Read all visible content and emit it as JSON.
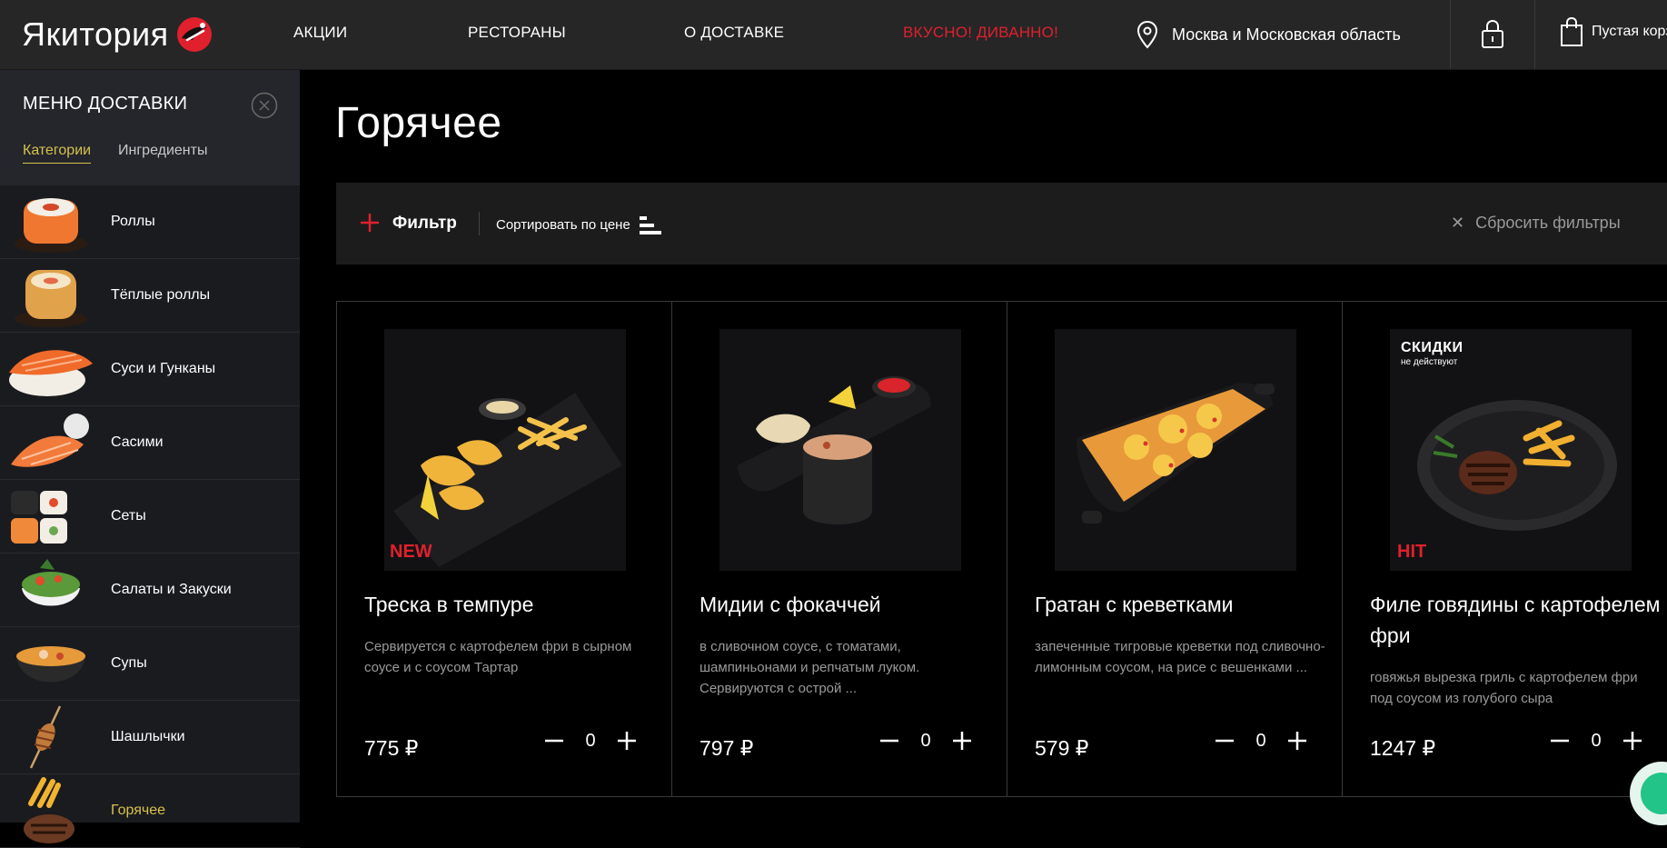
{
  "header": {
    "logo_text": "Якитория",
    "nav": [
      "АКЦИИ",
      "РЕСТОРАНЫ",
      "О ДОСТАВКЕ",
      "ВКУСНО! ДИВАННО!"
    ],
    "location": "Москва и Московская область",
    "cart_label": "Пустая корзина"
  },
  "sidebar": {
    "title": "МЕНЮ ДОСТАВКИ",
    "tabs": [
      "Категории",
      "Ингредиенты"
    ],
    "categories": [
      {
        "label": "Роллы"
      },
      {
        "label": "Тёплые роллы"
      },
      {
        "label": "Суси и Гунканы"
      },
      {
        "label": "Сасими"
      },
      {
        "label": "Сеты"
      },
      {
        "label": "Салаты и Закуски"
      },
      {
        "label": "Супы"
      },
      {
        "label": "Шашлычки"
      },
      {
        "label": "Горячее"
      }
    ]
  },
  "main": {
    "title": "Горячее",
    "filter_label": "Фильтр",
    "sort_label": "Сортировать по цене",
    "reset_label": "Сбросить фильтры",
    "products": [
      {
        "name": "Треска в темпуре",
        "desc": "Сервируется с картофелем фри в сырном соусе и с соусом Тартар",
        "price": "775 ₽",
        "qty": "0",
        "badge": "NEW"
      },
      {
        "name": "Мидии с фокаччей",
        "desc": "в сливочном соусе, с томатами, шампиньонами и репчатым луком. Сервируются с острой ...",
        "price": "797 ₽",
        "qty": "0",
        "badge": ""
      },
      {
        "name": "Гратан с креветками",
        "desc": "запеченные тигровые креветки под сливочно-лимонным соусом, на рисе с вешенками ...",
        "price": "579 ₽",
        "qty": "0",
        "badge": ""
      },
      {
        "name": "Филе говядины с картофелем фри",
        "desc": "говяжья вырезка гриль с картофелем фри под соусом из голубого сыра",
        "price": "1247 ₽",
        "qty": "0",
        "badge": "HIT",
        "promo_big": "СКИДКИ",
        "promo_small": "не действуют"
      }
    ]
  },
  "colors": {
    "accent_red": "#e0202d",
    "accent_yellow": "#d7c14a",
    "chat_green": "#22c487"
  }
}
